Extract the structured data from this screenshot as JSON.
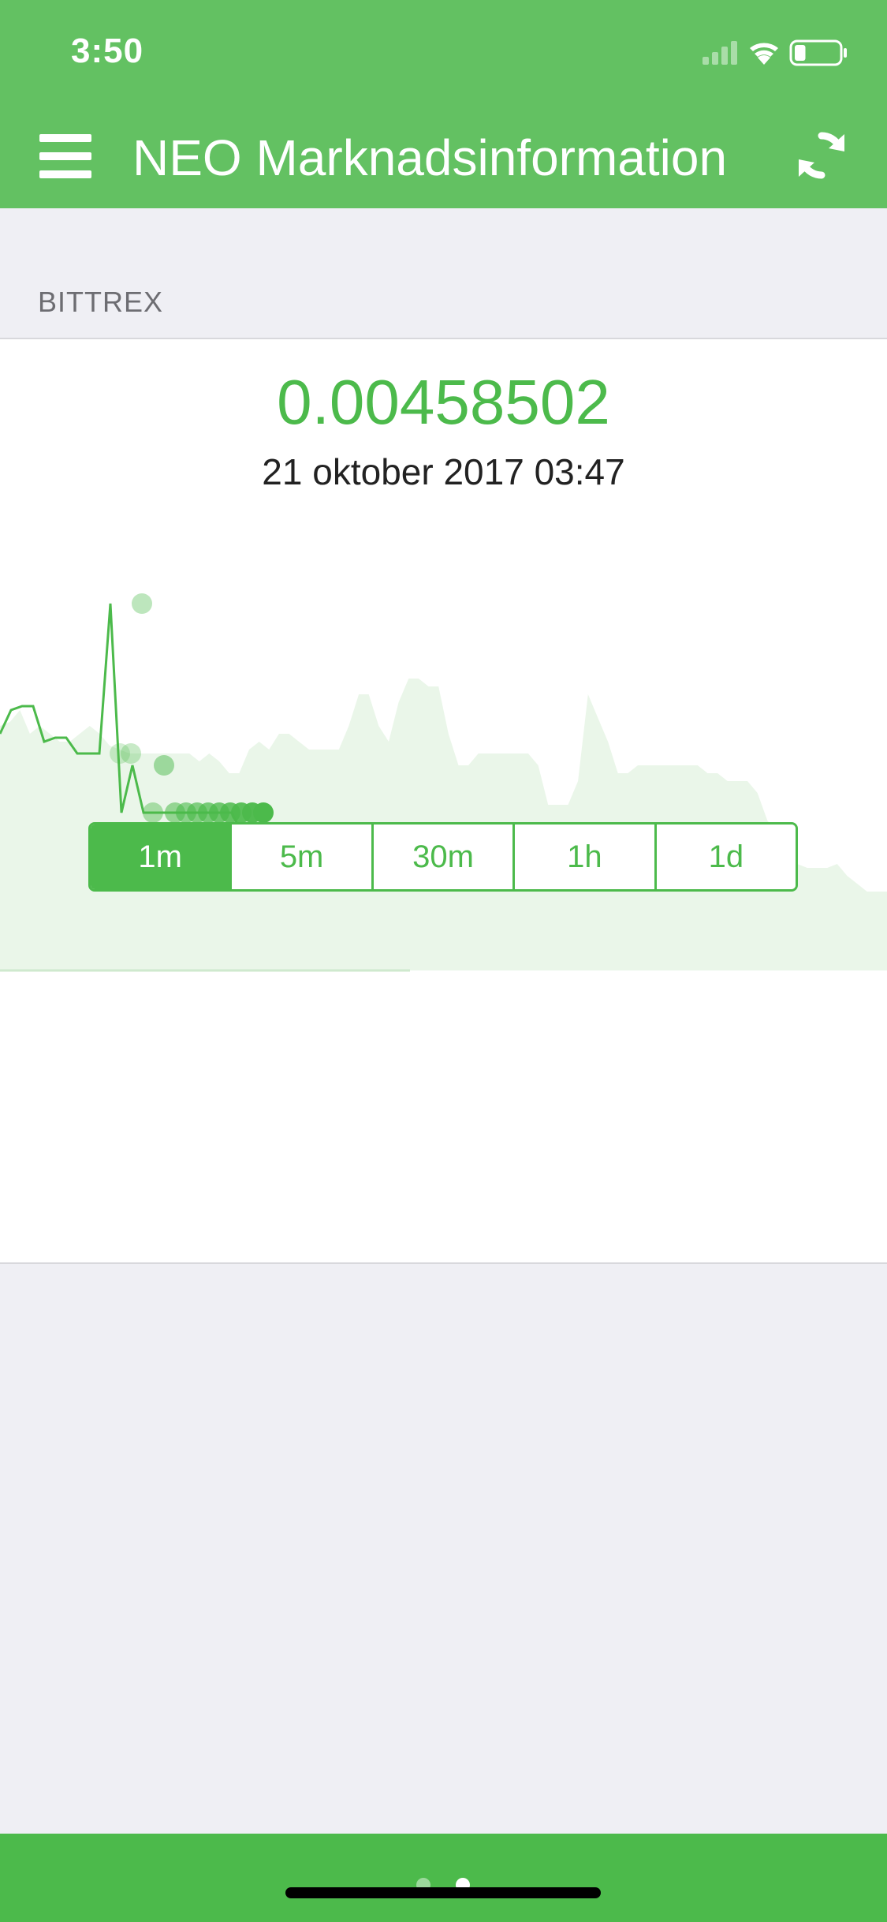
{
  "status_bar": {
    "time": "3:50",
    "icons": [
      "signal-icon",
      "wifi-icon",
      "battery-icon"
    ],
    "battery_level": 0.25
  },
  "nav": {
    "title": "NEO Marknadsinformation",
    "menu_icon": "hamburger-menu-icon",
    "refresh_icon": "refresh-icon"
  },
  "section": {
    "label": "BITTREX"
  },
  "price_card": {
    "price": "0.00458502",
    "timestamp": "21 oktober 2017 03:47"
  },
  "chart_data": {
    "type": "area",
    "title": "",
    "xlabel": "",
    "ylabel": "",
    "grid": false,
    "series": [
      {
        "values": [
          0.62,
          0.63,
          0.66,
          0.6,
          0.62,
          0.6,
          0.58,
          0.58,
          0.6,
          0.62,
          0.6,
          0.57,
          0.56,
          0.55,
          0.55,
          0.55,
          0.55,
          0.55,
          0.55,
          0.55,
          0.53,
          0.55,
          0.53,
          0.5,
          0.5,
          0.56,
          0.58,
          0.56,
          0.6,
          0.6,
          0.58,
          0.56,
          0.56,
          0.56,
          0.56,
          0.62,
          0.7,
          0.7,
          0.62,
          0.58,
          0.68,
          0.74,
          0.74,
          0.72,
          0.72,
          0.6,
          0.52,
          0.52,
          0.55,
          0.55,
          0.55,
          0.55,
          0.55,
          0.55,
          0.52,
          0.42,
          0.42,
          0.42,
          0.48,
          0.7,
          0.64,
          0.58,
          0.5,
          0.5,
          0.52,
          0.52,
          0.52,
          0.52,
          0.52,
          0.52,
          0.52,
          0.5,
          0.5,
          0.48,
          0.48,
          0.48,
          0.45,
          0.38,
          0.35,
          0.3,
          0.27,
          0.26,
          0.26,
          0.26,
          0.27,
          0.24,
          0.22,
          0.2,
          0.2,
          0.2
        ]
      },
      {
        "values": [
          0.6,
          0.66,
          0.67,
          0.67,
          0.58,
          0.59,
          0.59,
          0.55,
          0.55,
          0.55,
          0.93,
          0.4,
          0.52,
          0.4,
          0.4,
          0.4,
          0.4,
          0.4,
          0.4,
          0.4,
          0.4,
          0.4,
          0.34
        ]
      }
    ]
  },
  "interval_selector": {
    "options": [
      "1m",
      "5m",
      "30m",
      "1h",
      "1d"
    ],
    "selected": "1m"
  },
  "pager": {
    "pages": 2,
    "current": 2
  },
  "colors": {
    "primary": "#4cba4b",
    "header": "#63c162",
    "area_fill": "#eaf6e9",
    "background": "#efeff4"
  }
}
